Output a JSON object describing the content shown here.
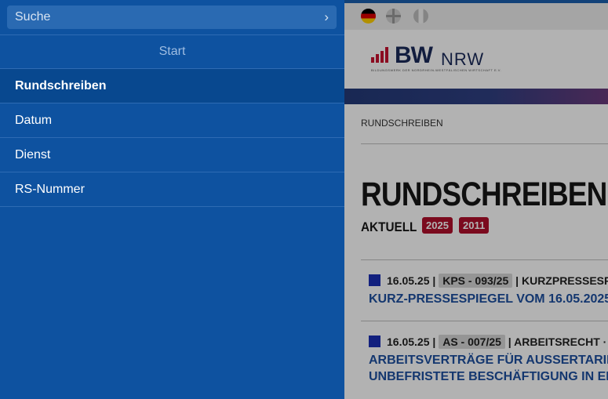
{
  "sidebar": {
    "search_label": "Suche",
    "start_label": "Start",
    "items": [
      {
        "label": "Rundschreiben",
        "active": true
      },
      {
        "label": "Datum",
        "active": false
      },
      {
        "label": "Dienst",
        "active": false
      },
      {
        "label": "RS-Nummer",
        "active": false
      }
    ]
  },
  "header": {
    "languages": [
      "de-flag-icon",
      "uk-flag-icon",
      "it-flag-icon"
    ],
    "logo_main": "BW",
    "logo_sub": "NRW",
    "logo_tagline": "BILDUNGSWERK DER NORDRHEIN-WESTFÄLISCHEN WIRTSCHAFT E.V."
  },
  "main": {
    "breadcrumb": "RUNDSCHREIBEN",
    "title": "RUNDSCHREIBEN",
    "subtitle": "AKTUELL",
    "years": [
      "2025",
      "2011"
    ],
    "entries": [
      {
        "date": "16.05.25",
        "code": "KPS - 093/25",
        "category": "KURZPRESSESP",
        "title_lines": [
          "KURZ-PRESSESPIEGEL VOM 16.05.2025"
        ]
      },
      {
        "date": "16.05.25",
        "code": "AS - 007/25",
        "category": "ARBEITSRECHT ·",
        "title_lines": [
          "ARBEITSVERTRÄGE FÜR AUSSERTARIFLIC",
          "UNBEFRISTETE BESCHÄFTIGUNG IN ENG"
        ]
      }
    ]
  },
  "colors": {
    "sidebar": "#0e52a0",
    "accent_red": "#b00f2c",
    "link_blue": "#1d4fa0"
  }
}
